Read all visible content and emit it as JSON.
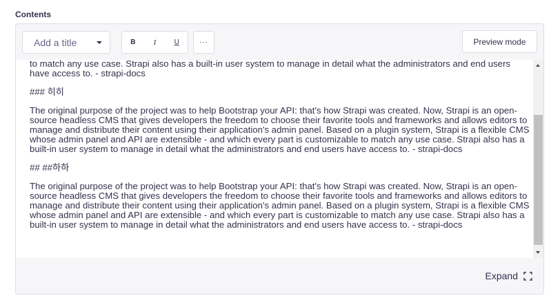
{
  "field": {
    "label": "Contents"
  },
  "toolbar": {
    "title_select": "Add a title",
    "bold": "B",
    "italic": "I",
    "underline": "U",
    "more": "···",
    "preview": "Preview mode"
  },
  "content": {
    "paragraphs": [
      "to match any use case. Strapi also has a built-in user system to manage in detail what the administrators and end users have access to. - strapi-docs",
      "### 히히",
      "The original purpose of the project was to help Bootstrap your API: that's how Strapi was created. Now, Strapi is an open-source headless CMS that gives developers the freedom to choose their favorite tools and frameworks and allows editors to manage and distribute their content using their application's admin panel. Based on a plugin system, Strapi is a flexible CMS whose admin panel and API are extensible - and which every part is customizable to match any use case. Strapi also has a built-in user system to manage in detail what the administrators and end users have access to. - strapi-docs",
      "## ##하하",
      "The original purpose of the project was to help Bootstrap your API: that's how Strapi was created. Now, Strapi is an open-source headless CMS that gives developers the freedom to choose their favorite tools and frameworks and allows editors to manage and distribute their content using their application's admin panel. Based on a plugin system, Strapi is a flexible CMS whose admin panel and API are extensible - and which every part is customizable to match any use case. Strapi also has a built-in user system to manage in detail what the administrators and end users have access to. - strapi-docs"
    ]
  },
  "footer": {
    "expand": "Expand",
    "expand_icon": "expand-icon"
  }
}
